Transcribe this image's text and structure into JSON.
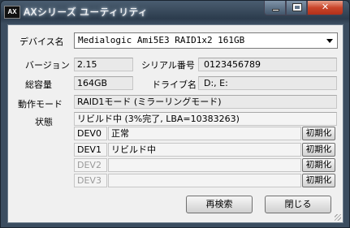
{
  "window": {
    "title": "AXシリーズ ユーティリティ",
    "app_icon": "AX"
  },
  "device": {
    "label": "デバイス名",
    "value": "Medialogic Ami5E3 RAID1x2 161GB"
  },
  "version": {
    "label": "バージョン",
    "value": "2.15"
  },
  "serial": {
    "label": "シリアル番号",
    "value": "0123456789"
  },
  "capacity": {
    "label": "総容量",
    "value": "164GB"
  },
  "drive": {
    "label": "ドライブ名",
    "value": "D:, E:"
  },
  "mode": {
    "label": "動作モード",
    "value": "RAID1モード (ミラーリングモード)"
  },
  "status": {
    "label": "状態",
    "value": "リビルド中 (3%完了, LBA=10383263)"
  },
  "devices": [
    {
      "name": "DEV0",
      "value": "正常",
      "button": "初期化",
      "enabled": true
    },
    {
      "name": "DEV1",
      "value": "リビルド中",
      "button": "初期化",
      "enabled": true
    },
    {
      "name": "DEV2",
      "value": "",
      "button": "初期化",
      "enabled": false
    },
    {
      "name": "DEV3",
      "value": "",
      "button": "初期化",
      "enabled": false
    }
  ],
  "buttons": {
    "rescan": "再検索",
    "close": "閉じる"
  }
}
